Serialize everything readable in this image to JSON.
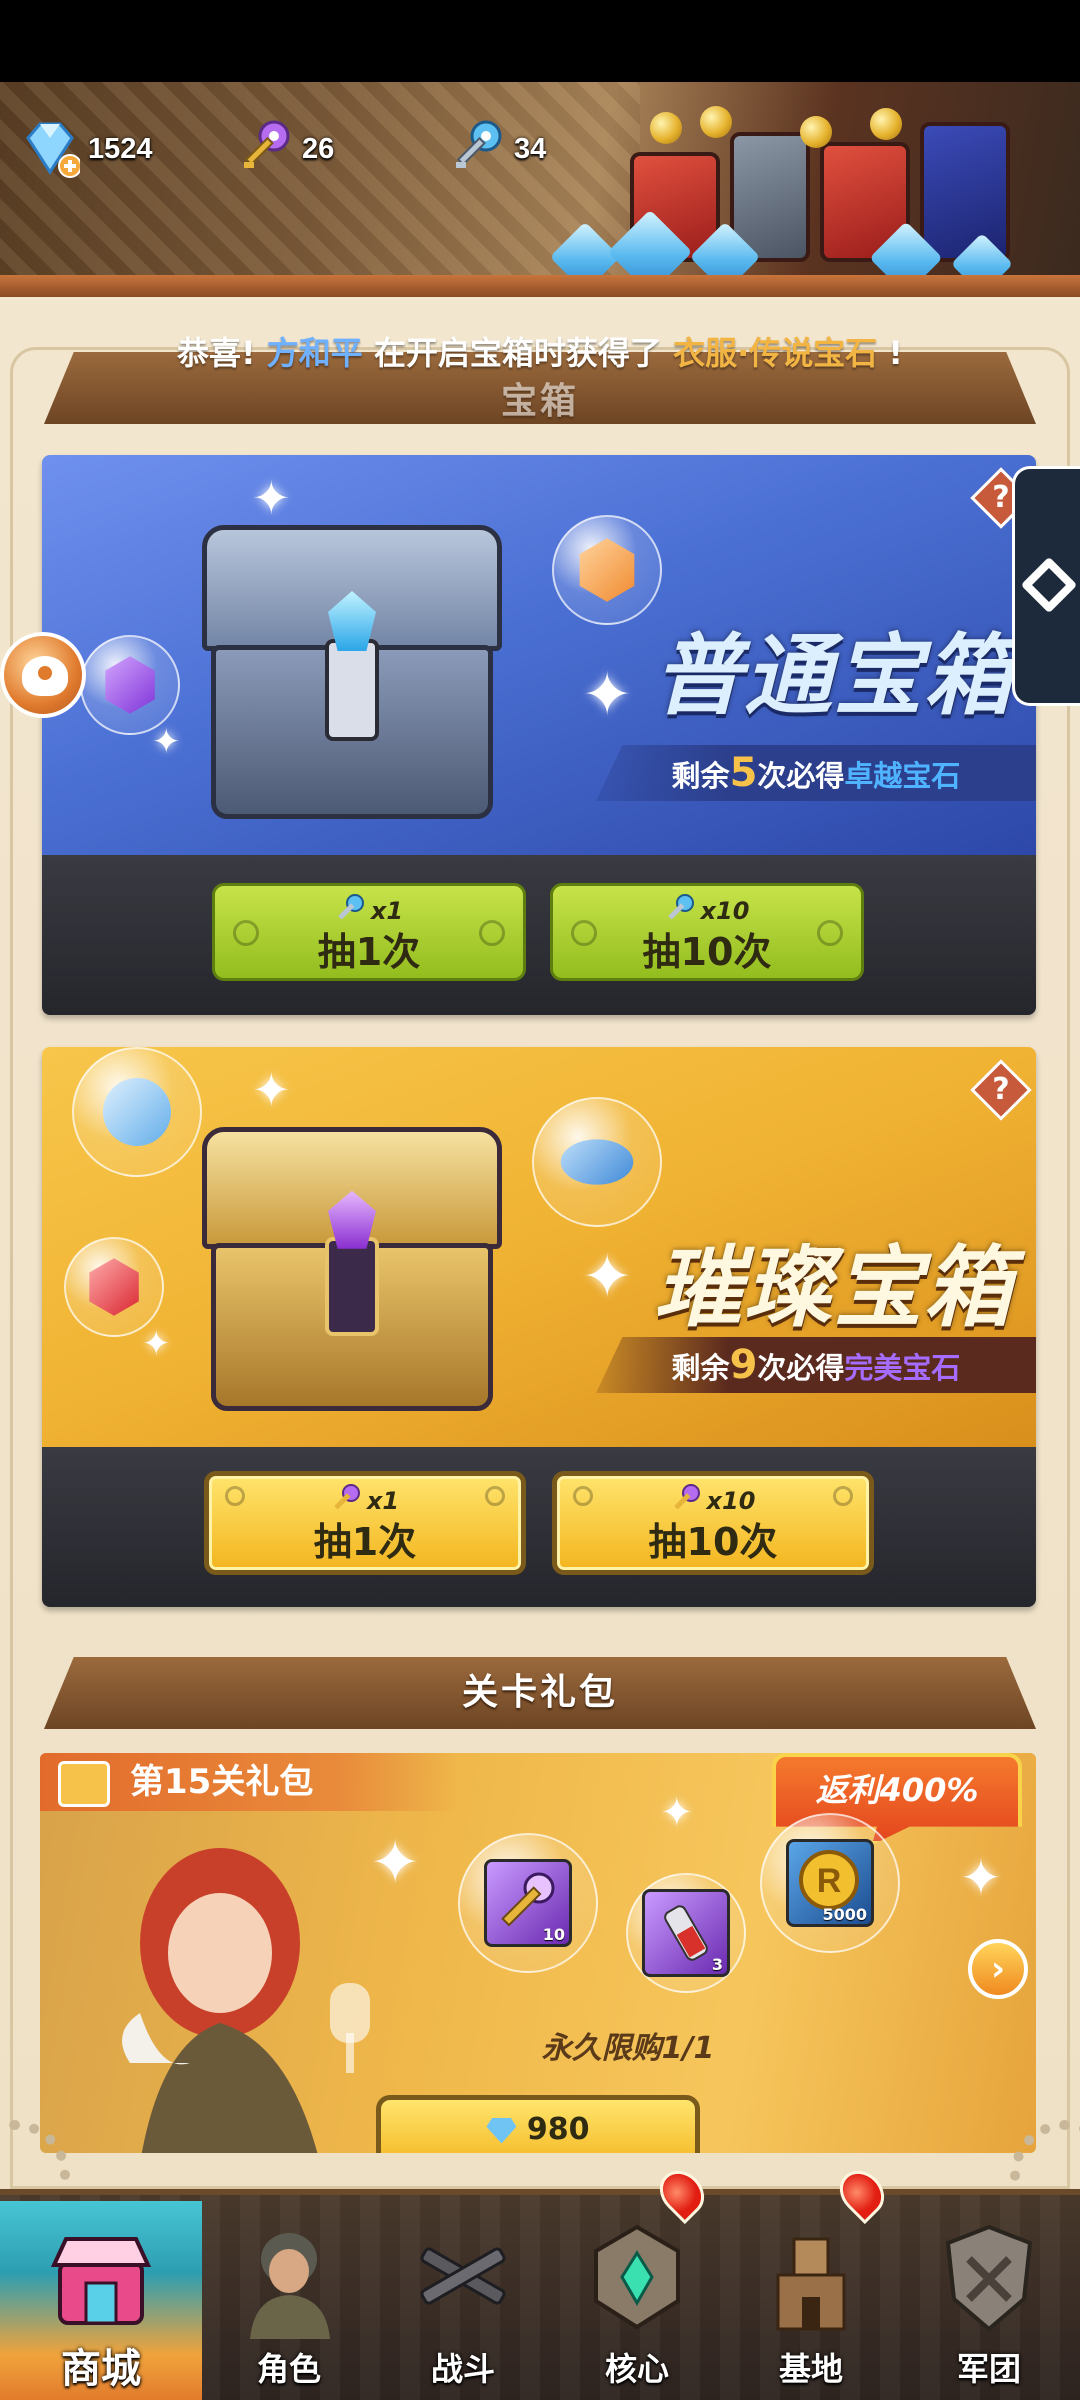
{
  "currency": [
    {
      "name": "diamond",
      "icon": "diamond-plus-icon",
      "value": "1524"
    },
    {
      "name": "purple-key",
      "icon": "purple-key-icon",
      "value": "26"
    },
    {
      "name": "blue-key",
      "icon": "blue-key-icon",
      "value": "34"
    }
  ],
  "marquee": {
    "prefix": "恭喜!",
    "player": "方和平",
    "middle": "在开启宝箱时获得了",
    "reward": "衣服·传说宝石",
    "suffix": "!"
  },
  "chest_section": {
    "title": "宝箱"
  },
  "chests": [
    {
      "name": "普通宝箱",
      "remain_prefix": "剩余",
      "remain_count": "5",
      "remain_mid": "次必得",
      "remain_reward": "卓越宝石",
      "help": "?",
      "buttons": [
        {
          "key_qty": "x1",
          "label": "抽1次"
        },
        {
          "key_qty": "x10",
          "label": "抽10次"
        }
      ]
    },
    {
      "name": "璀璨宝箱",
      "remain_prefix": "剩余",
      "remain_count": "9",
      "remain_mid": "次必得",
      "remain_reward": "完美宝石",
      "help": "?",
      "buttons": [
        {
          "key_qty": "x1",
          "label": "抽1次"
        },
        {
          "key_qty": "x10",
          "label": "抽10次"
        }
      ]
    }
  ],
  "stage_pack_section": {
    "title": "关卡礼包"
  },
  "stage_pack": {
    "label": "第15关礼包",
    "rebate": "返利400%",
    "items": [
      {
        "icon": "purple-key-item-icon",
        "qty": "10"
      },
      {
        "icon": "potion-item-icon",
        "qty": "3"
      },
      {
        "icon": "gold-coin-item-icon",
        "qty": "5000"
      }
    ],
    "limit": "永久限购1/1",
    "price": "980",
    "next": "›"
  },
  "nav": [
    {
      "label": "商城",
      "icon": "shop-icon",
      "active": true
    },
    {
      "label": "角色",
      "icon": "soldier-icon"
    },
    {
      "label": "战斗",
      "icon": "crossed-guns-icon"
    },
    {
      "label": "核心",
      "icon": "core-icon",
      "badge": true
    },
    {
      "label": "基地",
      "icon": "base-tower-icon",
      "badge": true
    },
    {
      "label": "军团",
      "icon": "legion-shield-icon"
    }
  ],
  "colors": {
    "common_chest_bg": "#4a6fd3",
    "premium_chest_bg": "#f0b232",
    "green_button": "#a8cf2c",
    "gold_button": "#f8cb3a",
    "highlight_blue": "#4fb3ff",
    "highlight_purple": "#a56cff"
  }
}
